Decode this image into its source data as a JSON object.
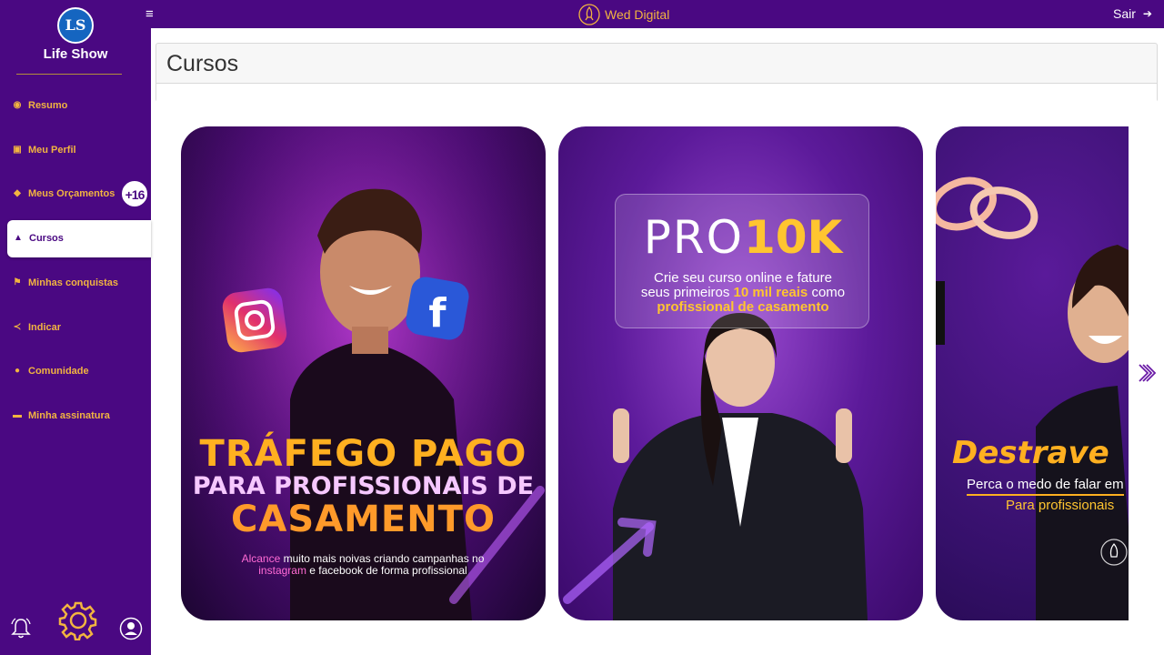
{
  "sidebar": {
    "logo_initials": "LS",
    "logo_name": "Life Show",
    "items": [
      {
        "label": "Resumo",
        "icon": "dashboard-icon"
      },
      {
        "label": "Meu Perfil",
        "icon": "id-card-icon"
      },
      {
        "label": "Meus Orçamentos",
        "icon": "tag-icon",
        "badge": "+16"
      },
      {
        "label": "Cursos",
        "icon": "graduation-cap-icon",
        "active": true
      },
      {
        "label": "Minhas conquistas",
        "icon": "flag-icon"
      },
      {
        "label": "Indicar",
        "icon": "share-icon"
      },
      {
        "label": "Comunidade",
        "icon": "users-icon"
      },
      {
        "label": "Minha assinatura",
        "icon": "credit-card-icon"
      }
    ]
  },
  "topbar": {
    "menu_icon": "hamburger-icon",
    "brand": "Wed Digital",
    "logout_label": "Sair"
  },
  "page": {
    "title": "Cursos"
  },
  "courses": [
    {
      "title_line1": "TRÁFEGO PAGO",
      "title_line2": "PARA PROFISSIONAIS DE",
      "title_line3": "CASAMENTO",
      "sub_pink1": "Alcance",
      "sub_text1": " muito mais noivas criando campanhas no",
      "sub_pink2": "instagram",
      "sub_text2": " e facebook de forma profissional"
    },
    {
      "title_a": "PRO",
      "title_b": "10K",
      "sub_line1": "Crie seu curso online e fature",
      "sub_line2a": "seus primeiros ",
      "sub_line2b": "10 mil reais",
      "sub_line2c": " como",
      "sub_line3": "profissional de casamento"
    },
    {
      "title": "Destrave",
      "sub_line1": "Perca o medo de falar em",
      "sub_line2": "Para profissionais"
    }
  ],
  "colors": {
    "brand_purple": "#4a0882",
    "accent_gold": "#f2b440"
  }
}
